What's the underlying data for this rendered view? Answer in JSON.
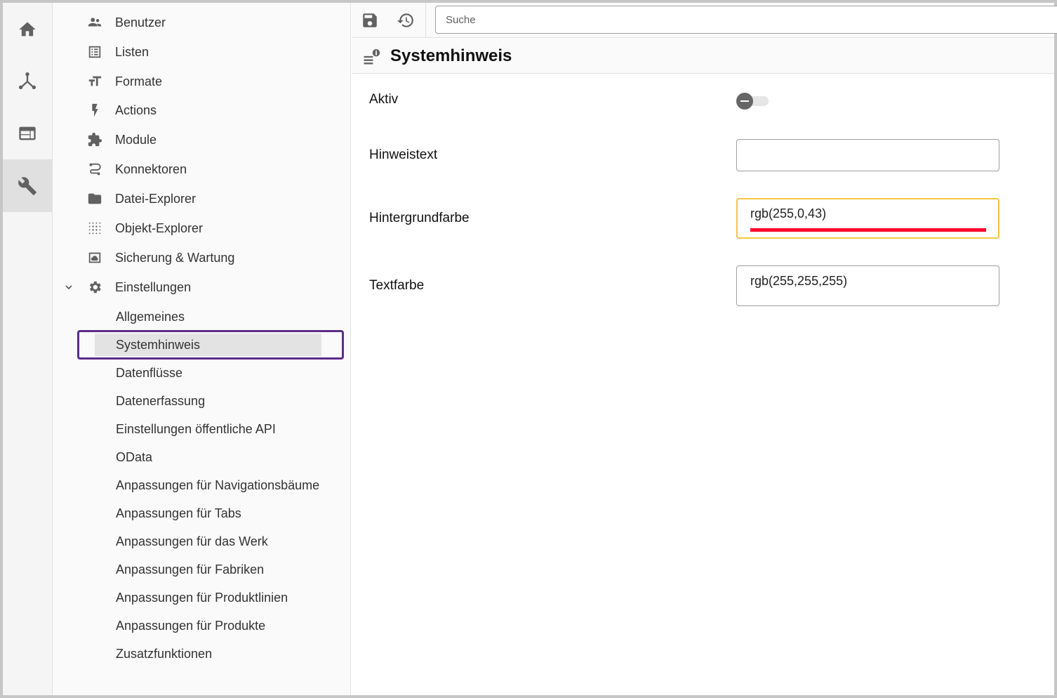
{
  "rail": {
    "items": [
      {
        "icon": "home-icon",
        "active": false
      },
      {
        "icon": "hierarchy-icon",
        "active": false
      },
      {
        "icon": "web-icon",
        "active": false
      },
      {
        "icon": "wrench-icon",
        "active": true
      }
    ]
  },
  "nav": {
    "items": [
      {
        "label": "Benutzer",
        "icon": "users-icon"
      },
      {
        "label": "Listen",
        "icon": "list-icon"
      },
      {
        "label": "Formate",
        "icon": "text-format-icon"
      },
      {
        "label": "Actions",
        "icon": "bolt-icon"
      },
      {
        "label": "Module",
        "icon": "puzzle-icon"
      },
      {
        "label": "Konnektoren",
        "icon": "route-icon"
      },
      {
        "label": "Datei-Explorer",
        "icon": "folder-icon"
      },
      {
        "label": "Objekt-Explorer",
        "icon": "dots-grid-icon"
      },
      {
        "label": "Sicherung & Wartung",
        "icon": "backup-icon"
      },
      {
        "label": "Einstellungen",
        "icon": "gear-icon",
        "expanded": true
      }
    ],
    "sub_items": [
      {
        "label": "Allgemeines",
        "selected": false
      },
      {
        "label": "Systemhinweis",
        "selected": true
      },
      {
        "label": "Datenflüsse",
        "selected": false
      },
      {
        "label": "Datenerfassung",
        "selected": false
      },
      {
        "label": "Einstellungen öffentliche API",
        "selected": false
      },
      {
        "label": "OData",
        "selected": false
      },
      {
        "label": "Anpassungen für Navigationsbäume",
        "selected": false
      },
      {
        "label": "Anpassungen für Tabs",
        "selected": false
      },
      {
        "label": "Anpassungen für das Werk",
        "selected": false
      },
      {
        "label": "Anpassungen für Fabriken",
        "selected": false
      },
      {
        "label": "Anpassungen für Produktlinien",
        "selected": false
      },
      {
        "label": "Anpassungen für Produkte",
        "selected": false
      },
      {
        "label": "Zusatzfunktionen",
        "selected": false
      }
    ]
  },
  "toolbar": {
    "save_icon": "save-icon",
    "restore_icon": "restore-icon",
    "search_placeholder": "Suche"
  },
  "page": {
    "title": "Systemhinweis",
    "icon": "notification-settings-icon"
  },
  "form": {
    "aktiv_label": "Aktiv",
    "aktiv_value": false,
    "hinweistext_label": "Hinweistext",
    "hinweistext_value": "",
    "hintergrundfarbe_label": "Hintergrundfarbe",
    "hintergrundfarbe_value": "rgb(255,0,43)",
    "textfarbe_label": "Textfarbe",
    "textfarbe_value": "rgb(255,255,255)"
  },
  "colors": {
    "accent_focus": "#f5c542",
    "selection_outline": "#5c2d8a",
    "background_swatch": "#ff002b"
  }
}
